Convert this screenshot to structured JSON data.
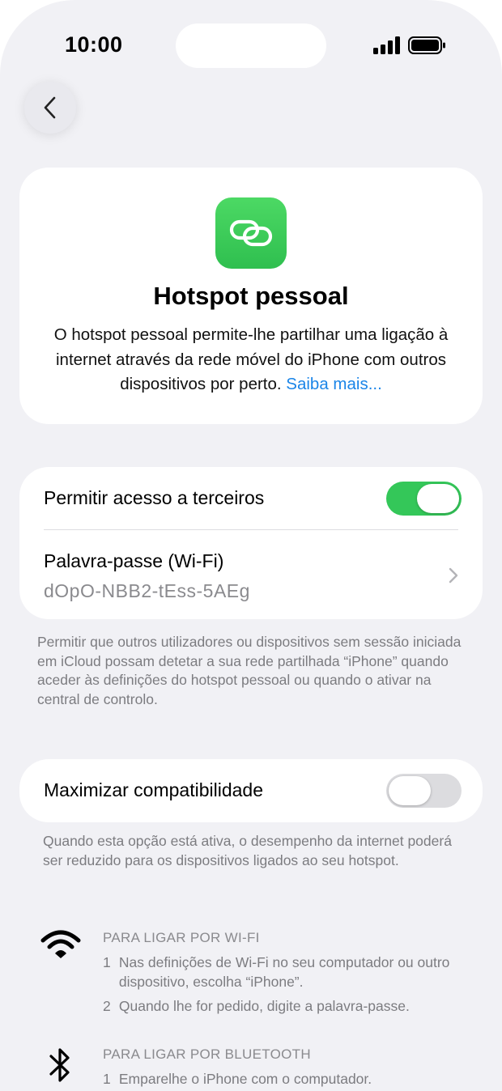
{
  "status_bar": {
    "time": "10:00"
  },
  "nav": {
    "back_label": "Voltar"
  },
  "hero": {
    "title": "Hotspot pessoal",
    "description": "O hotspot pessoal permite-lhe partilhar uma ligação à internet através da rede móvel do iPhone com outros dispositivos por perto.",
    "link": "Saiba mais..."
  },
  "access_group": {
    "allow_label": "Permitir acesso a terceiros",
    "allow_on": true,
    "password_label": "Palavra-passe (Wi-Fi)",
    "password_value": "dOpO-NBB2-tEss-5AEg"
  },
  "access_footnote": "Permitir que outros utilizadores ou dispositivos sem sessão iniciada em iCloud possam detetar a sua rede partilhada “iPhone” quando aceder às definições do hotspot pessoal ou quando o ativar na central de controlo.",
  "compat_group": {
    "label": "Maximizar compatibilidade",
    "on": false
  },
  "compat_footnote": "Quando esta opção está ativa, o desempenho da internet poderá ser reduzido para os dispositivos ligados ao seu hotspot.",
  "wifi_section": {
    "title": "PARA LIGAR POR WI-FI",
    "steps": [
      {
        "num": "1",
        "text": "Nas definições de Wi-Fi no seu computador ou outro dispositivo, escolha “iPhone”."
      },
      {
        "num": "2",
        "text": "Quando lhe for pedido, digite a palavra-passe."
      }
    ]
  },
  "bluetooth_section": {
    "title": "PARA LIGAR POR BLUETOOTH",
    "steps": [
      {
        "num": "1",
        "text": "Emparelhe o iPhone com o computador."
      }
    ]
  },
  "colors": {
    "accent": "#34c759",
    "link": "#1a85e8",
    "background": "#f1f1f5"
  },
  "icons": [
    "chevron-left-icon",
    "hotspot-link-icon",
    "chevron-right-icon",
    "wifi-icon",
    "bluetooth-icon",
    "cellular-signal-icon",
    "battery-icon"
  ]
}
